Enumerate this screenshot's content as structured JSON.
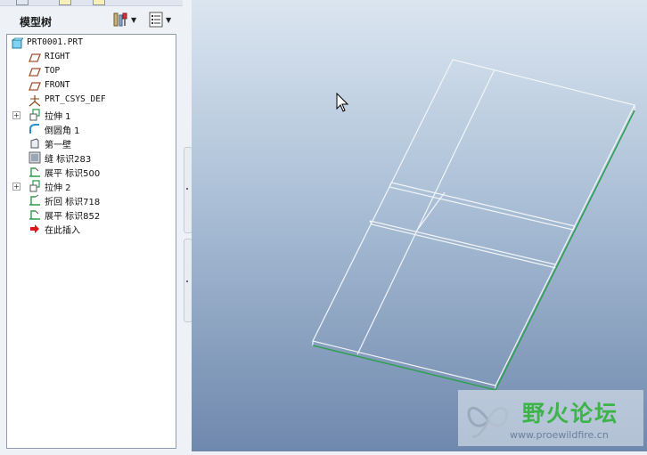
{
  "model_tree": {
    "title": "模型树",
    "settings_icon": "tools-icon",
    "show_icon": "list-icon",
    "items": [
      {
        "label": "PRT0001.PRT",
        "icon": "part-icon",
        "expandable": false
      },
      {
        "label": "RIGHT",
        "icon": "datum-plane-icon",
        "expandable": false
      },
      {
        "label": "TOP",
        "icon": "datum-plane-icon",
        "expandable": false
      },
      {
        "label": "FRONT",
        "icon": "datum-plane-icon",
        "expandable": false
      },
      {
        "label": "PRT_CSYS_DEF",
        "icon": "csys-icon",
        "expandable": false
      },
      {
        "label": "拉伸 1",
        "icon": "extrude-icon",
        "expandable": true
      },
      {
        "label": "倒圆角 1",
        "icon": "round-icon",
        "expandable": false
      },
      {
        "label": "第一壁",
        "icon": "first-wall-icon",
        "expandable": false
      },
      {
        "label": "缝 标识283",
        "icon": "rip-icon",
        "expandable": false
      },
      {
        "label": "展平 标识500",
        "icon": "unbend-icon",
        "expandable": false
      },
      {
        "label": "拉伸 2",
        "icon": "extrude-icon",
        "expandable": true
      },
      {
        "label": "折回 标识718",
        "icon": "bend-back-icon",
        "expandable": false
      },
      {
        "label": "展平 标识852",
        "icon": "unbend-icon",
        "expandable": false
      },
      {
        "label": "在此插入",
        "icon": "insert-here-arrow-icon",
        "expandable": false
      }
    ]
  },
  "watermark": {
    "title": "野火论坛",
    "url": "www.proewildfire.cn"
  },
  "colors": {
    "tree_background": "#ffffff",
    "panel_background": "#eef2f7",
    "viewport_top": "#dbe5f0",
    "viewport_bottom": "#6f88ad",
    "edge_highlight": "#2f9e53",
    "wm_green": "#3db34a"
  }
}
